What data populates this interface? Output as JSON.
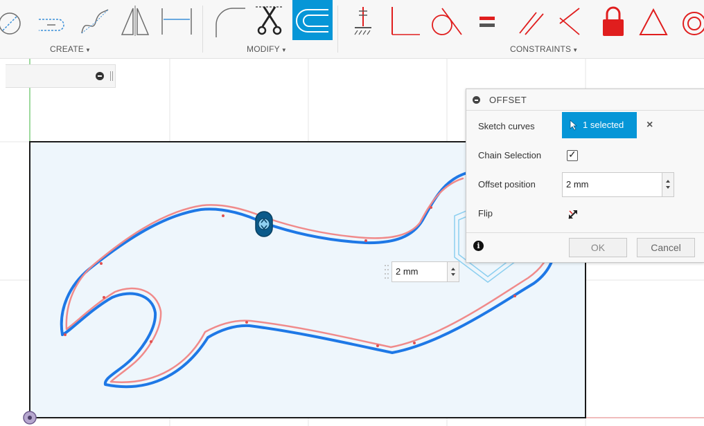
{
  "toolbar": {
    "groups": [
      {
        "label": "CREATE",
        "caret": "▼"
      },
      {
        "label": "MODIFY",
        "caret": "▼"
      },
      {
        "label": "CONSTRAINTS",
        "caret": "▼"
      }
    ]
  },
  "offset_dialog": {
    "title": "OFFSET",
    "sketch_curves_label": "Sketch curves",
    "selection_text": "1 selected",
    "chain_selection_label": "Chain Selection",
    "chain_selection_checked": true,
    "offset_position_label": "Offset position",
    "offset_position_value": "2 mm",
    "flip_label": "Flip",
    "ok_label": "OK",
    "cancel_label": "Cancel"
  },
  "canvas": {
    "inline_offset_value": "2 mm"
  },
  "colors": {
    "accent": "#0696d7",
    "offset_curve": "#1e78e6",
    "original_curve": "#f08a8a",
    "constraint_red": "#e01e1e"
  }
}
